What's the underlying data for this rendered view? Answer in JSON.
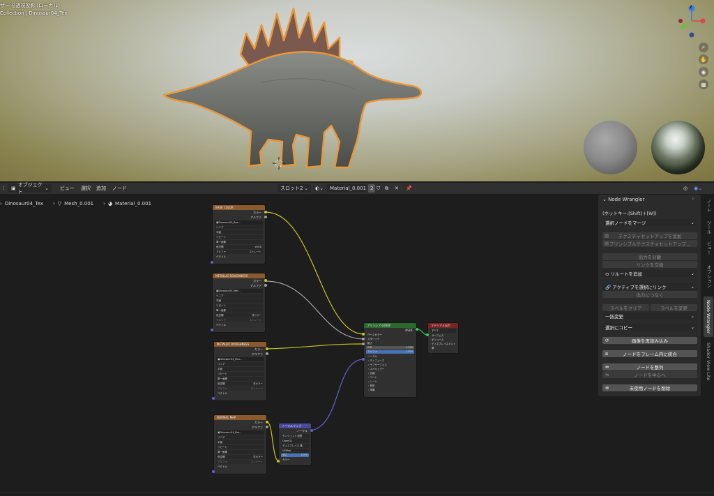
{
  "viewport": {
    "mode_line": "ザー ◎透視投影 (ローカル)",
    "collection_line": "Collection | Dinosaur04_Tex",
    "gizmo_z": "Z"
  },
  "header": {
    "mode": "オブジェクト",
    "menu": [
      "ビュー",
      "選択",
      "追加",
      "ノード"
    ],
    "slot": "スロット2",
    "material": "Material_0.001",
    "users": "2"
  },
  "breadcrumb": [
    "Dinosaur04_Tex",
    "Mesh_0.001",
    "Material_0.001"
  ],
  "nodes": {
    "base_color": {
      "title": "BASE COLOR",
      "outputs": [
        "カラー",
        "アルファ"
      ],
      "image": "Dinosaur04_Bas...",
      "fields": [
        [
          "リニア",
          ""
        ],
        [
          "平面",
          ""
        ],
        [
          "リピート",
          ""
        ],
        [
          "単一画像",
          ""
        ],
        [
          "色空間",
          "sRGB"
        ],
        [
          "アルファ",
          "ストレート"
        ]
      ],
      "input": "ベクトル"
    },
    "metal1": {
      "title": "METALLIC ROUGHNESS",
      "outputs": [
        "カラー",
        "アルファ"
      ],
      "image": "Dinosaur04_Met...",
      "fields": [
        [
          "リニア",
          ""
        ],
        [
          "平面",
          ""
        ],
        [
          "リピート",
          ""
        ],
        [
          "単一画像",
          ""
        ],
        [
          "色空間",
          "非カラー"
        ],
        [
          "アルファ",
          "ストレート"
        ]
      ],
      "input": "ベクトル"
    },
    "metal2": {
      "title": "METALLIC ROUGHNESS",
      "outputs": [
        "カラー",
        "アルファ"
      ],
      "image": "Dinosaur04_Rou...",
      "fields": [
        [
          "リニア",
          ""
        ],
        [
          "平面",
          ""
        ],
        [
          "リピート",
          ""
        ],
        [
          "単一画像",
          ""
        ],
        [
          "色空間",
          "非カラー"
        ],
        [
          "アルファ",
          "ストレート"
        ]
      ],
      "input": "ベクトル"
    },
    "normal": {
      "title": "NORMAL MAP",
      "outputs": [
        "カラー",
        "アルファ"
      ],
      "image": "Dinosaur04_Nor...",
      "fields": [
        [
          "リニア",
          ""
        ],
        [
          "平面",
          ""
        ],
        [
          "リピート",
          ""
        ],
        [
          "単一画像",
          ""
        ],
        [
          "色空間",
          "非カラー"
        ],
        [
          "アルファ",
          "ストレート"
        ]
      ],
      "input": "ベクトル"
    },
    "bsdf": {
      "title": "プリンシプルBSDF",
      "output": "BSDF",
      "inputs": [
        "ベースカラー",
        "メタリック",
        "粗さ"
      ],
      "ior_label": "IOR",
      "ior_val": "1.500",
      "alpha_label": "アルファ",
      "alpha_val": "1.000",
      "normal": "ノーマル",
      "subs": [
        "ディフューズ",
        "サブサーフェス",
        "スペキュラー",
        "伝播",
        "コート",
        "シーン",
        "放射",
        "薄膜"
      ]
    },
    "output": {
      "title": "マテリアル出力",
      "target": "すべて",
      "inputs": [
        "サーフェス",
        "ボリューム",
        "ディスプレイスメント",
        "厚"
      ]
    },
    "normal_map": {
      "title": "ノーマルマップ",
      "output": "ノーマル",
      "space": "タンジェント空間",
      "opt": "OpenGL",
      "disp": "ディスプレイス 跳",
      "uv": "UVMap",
      "strength_label": "強さ",
      "strength_val": "1.000",
      "color": "カラー"
    }
  },
  "panel": {
    "title": "Node Wrangler",
    "hotkey": "(ホットキー:[Shift]＋[W])",
    "merge": "選択ノードをマージ",
    "tex_setup": "テクスチャセットアップを追加",
    "principled_setup": "プリンシプルテクスチャセットアップ...",
    "split_output": "出力を分離",
    "swap_links": "リンクを交換",
    "add_reroute": "リルートを追加",
    "link_active": "アクティブを選択にリンク",
    "connect_output": "出力につなぐ",
    "clear_label": "ラベルをクリア",
    "modify_label": "ラベルを変更",
    "batch_change": "一括変更",
    "copy_to_selected": "選択にコピー",
    "reload_images": "画像を再読み込み",
    "frame_selected": "ノードをフレーム内に統合",
    "align_nodes": "ノードを整列",
    "center_nodes": "ノードを中心へ",
    "delete_unused": "未使用ノードを削除"
  },
  "tabs": [
    "ノード",
    "ツール",
    "ビュー",
    "オプション",
    "Node Wrangler",
    "Shader View Lite"
  ],
  "colors": {
    "wire_yellow": "#c7c729",
    "wire_grey": "#a1a1a1",
    "wire_blue": "#6363c7",
    "selection": "#e8973a"
  }
}
